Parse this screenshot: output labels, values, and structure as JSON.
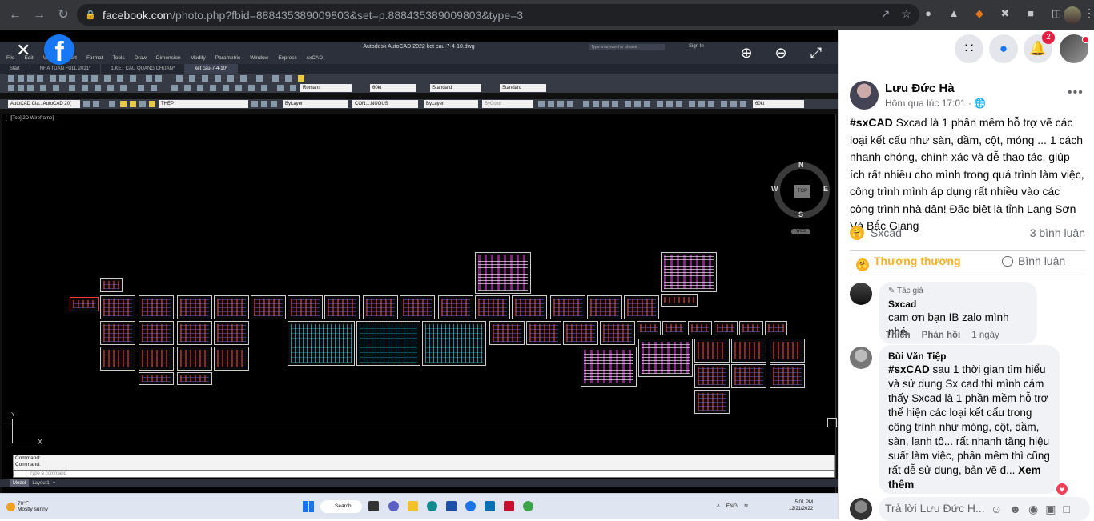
{
  "browser": {
    "url_host": "facebook.com",
    "url_path": "/photo.php?fbid=888435389009803&set=p.888435389009803&type=3"
  },
  "autocad": {
    "title": "Autodesk AutoCAD 2022    ket cau-7-4-10.dwg",
    "search_placeholder": "Type a keyword or phrase",
    "sign_in": "Sign In",
    "menu": [
      "File",
      "Edit",
      "View",
      "Insert",
      "Format",
      "Tools",
      "Draw",
      "Dimension",
      "Modify",
      "Parametric",
      "Window",
      "Express",
      "sxCAD"
    ],
    "tabs": [
      "Start",
      "NHA TUAN FULL 2021*",
      "1.KET CAU QUANG CHUAN*",
      "ket cau-7-4-10*"
    ],
    "toolbar_fields": {
      "font": "Romans",
      "dimstyle": "60kt",
      "tablestyle": "Standard",
      "mleaderstyle": "Standard",
      "workspace": "AutoCAD Cla...AutoCAD 20(",
      "layer": "THEP",
      "color": "ByLayer",
      "linetype": "CON....NUOUS",
      "lineweight": "ByLayer",
      "plotstyle": "ByColor",
      "scale": "60kt"
    },
    "viewport_label": "[–][Top][2D Wireframe]",
    "viewcube": {
      "north": "N",
      "south": "S",
      "east": "E",
      "west": "W",
      "face": "TOP",
      "wcs": "WCS"
    },
    "ucs": {
      "x": "X",
      "y": "Y"
    },
    "command_history": [
      "Command:",
      "Command:"
    ],
    "command_placeholder": "Type a command",
    "layout_tabs": [
      "Model",
      "Layout1",
      "+"
    ]
  },
  "taskbar": {
    "weather_temp": "70°F",
    "weather_desc": "Mostly sunny",
    "search_label": "Search",
    "language": "ENG",
    "time": "5:01 PM",
    "date": "12/21/2022"
  },
  "facebook": {
    "notification_count": "2",
    "post": {
      "author": "Lưu Đức Hà",
      "time": "Hôm qua lúc 17:01 ·",
      "hashtag": "#sxCAD",
      "text": " Sxcad là 1 phần mềm hỗ trợ vẽ các loại kết cấu như sàn, dầm, cột, móng ... 1 cách nhanh chóng, chính xác và dễ thao tác, giúp ích rất nhiều cho mình trong quá trình làm việc, công trình mình áp dụng rất nhiều vào các công trình nhà dân! Đặc biệt là tỉnh Lạng Sơn Và Bắc Giang",
      "reaction_name": "Sxcad",
      "comment_count": "3 bình luận",
      "like_label": "Thương thương",
      "comment_label": "Bình luận"
    },
    "comments": [
      {
        "badge": "Tác giả",
        "author": "Sxcad",
        "text": "cam ơn bạn IB zalo mình nhé.",
        "like": "Thích",
        "reply": "Phản hồi",
        "time": "1 ngày"
      },
      {
        "author": "Bùi Văn Tiệp",
        "hashtag": "#sxCAD",
        "text": " sau 1 thời gian tìm hiểu và sử dụng Sx cad thì mình cảm thấy Sxcad là 1 phần mềm hỗ trợ thể hiện các loại kết cấu trong công trình như móng, cột, dầm, sàn, lanh tô... rất nhanh tăng hiệu suất làm việc, phần mềm thì cũng rất dễ sử dụng, bản vẽ đ...",
        "see_more": "Xem thêm"
      }
    ],
    "reply_placeholder": "Trả lời Lưu Đức H..."
  },
  "colors": {
    "facebook_blue": "#1877f2",
    "notification_red": "#e41e3f",
    "care_reaction": "#f7b125"
  }
}
